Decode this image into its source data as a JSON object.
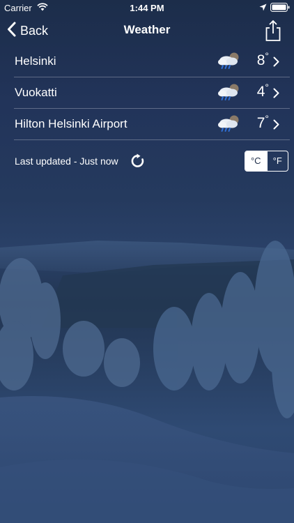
{
  "status_bar": {
    "carrier": "Carrier",
    "time": "1:44 PM",
    "icons": [
      "wifi-icon",
      "location-arrow-icon",
      "battery-icon"
    ]
  },
  "nav": {
    "back_label": "Back",
    "title": "Weather",
    "back_icon": "chevron-left-icon",
    "share_icon": "share-icon"
  },
  "locations": [
    {
      "name": "Helsinki",
      "temperature": "8",
      "degree_symbol": "°",
      "icon": "cloud-rain-night-icon"
    },
    {
      "name": "Vuokatti",
      "temperature": "4",
      "degree_symbol": "°",
      "icon": "cloud-rain-night-icon"
    },
    {
      "name": "Hilton Helsinki Airport",
      "temperature": "7",
      "degree_symbol": "°",
      "icon": "cloud-rain-night-icon"
    }
  ],
  "footer": {
    "updated_text": "Last updated - Just now",
    "refresh_icon": "refresh-icon",
    "units": {
      "celsius": "°C",
      "fahrenheit": "°F",
      "selected": "celsius"
    }
  },
  "colors": {
    "background": "#1d2d47",
    "text": "#ffffff",
    "separator": "rgba(255,255,255,0.28)"
  }
}
